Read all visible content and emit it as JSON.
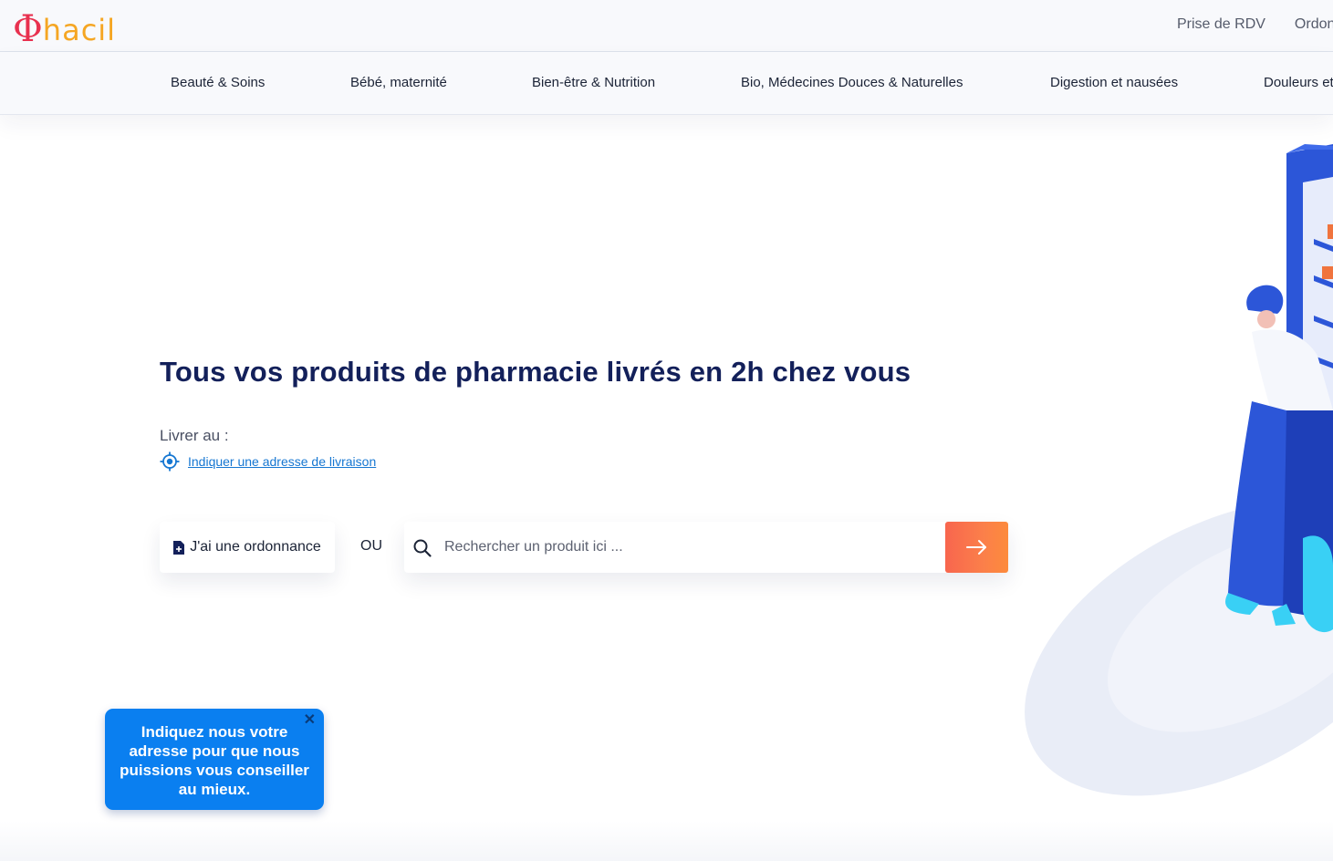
{
  "brand": {
    "logo_symbol": "Φ",
    "logo_text": "hacil",
    "colors": {
      "symbol": "#e8314f",
      "wordmark": "#f5a623",
      "navy": "#13205a",
      "accent_blue": "#0a7ff0",
      "cta_orange": "#f8664e"
    }
  },
  "header": {
    "links": [
      "Prise de RDV",
      "Ordon"
    ]
  },
  "categories": [
    "Beauté & Soins",
    "Bébé, maternité",
    "Bien-être & Nutrition",
    "Bio, Médecines Douces & Naturelles",
    "Digestion et nausées",
    "Douleurs et"
  ],
  "hero": {
    "title": "Tous vos produits de pharmacie livrés en 2h chez vous",
    "deliver_label": "Livrer au :",
    "address_link": "Indiquer une adresse de livraison",
    "prescription_button": "J'ai une ordonnance",
    "or_label": "OU",
    "search": {
      "placeholder": "Rechercher un produit ici ...",
      "value": "",
      "icon": "search-icon",
      "submit_icon": "arrow-right-icon"
    }
  },
  "tooltip": {
    "text": "Indiquez nous votre adresse pour que nous puissions vous conseiller au mieux.",
    "close": "✕"
  }
}
